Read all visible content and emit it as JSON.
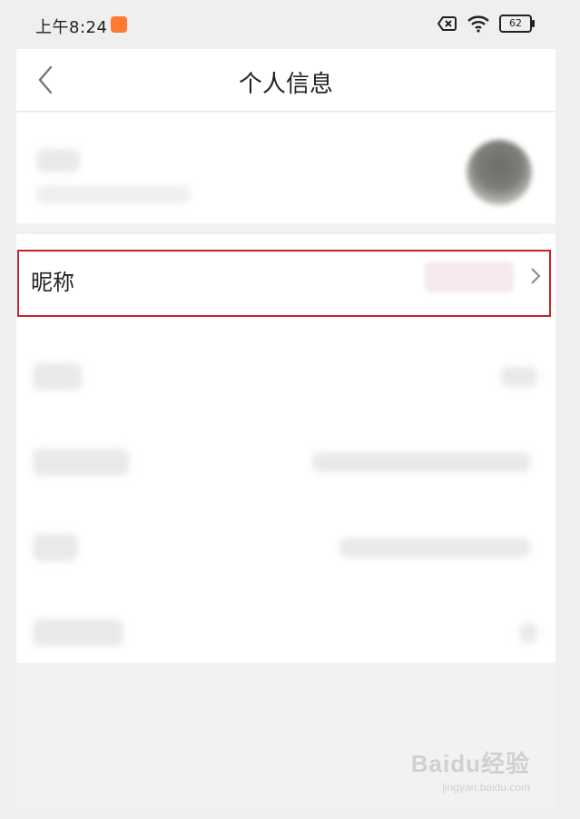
{
  "status_bar": {
    "time": "上午8:24",
    "battery": "62",
    "icons": [
      "app-badge-icon",
      "no-sim-icon",
      "wifi-icon",
      "battery-icon"
    ]
  },
  "nav": {
    "title": "个人信息",
    "back_icon": "chevron-left-icon"
  },
  "profile": {
    "nickname_label": "昵称",
    "chevron_icon": "chevron-right-icon"
  },
  "watermark": {
    "text": "Baidu经验",
    "sub": "jingyan.baidu.com"
  },
  "colors": {
    "highlight": "#c8232b",
    "app_badge": "#ff7a2f"
  }
}
